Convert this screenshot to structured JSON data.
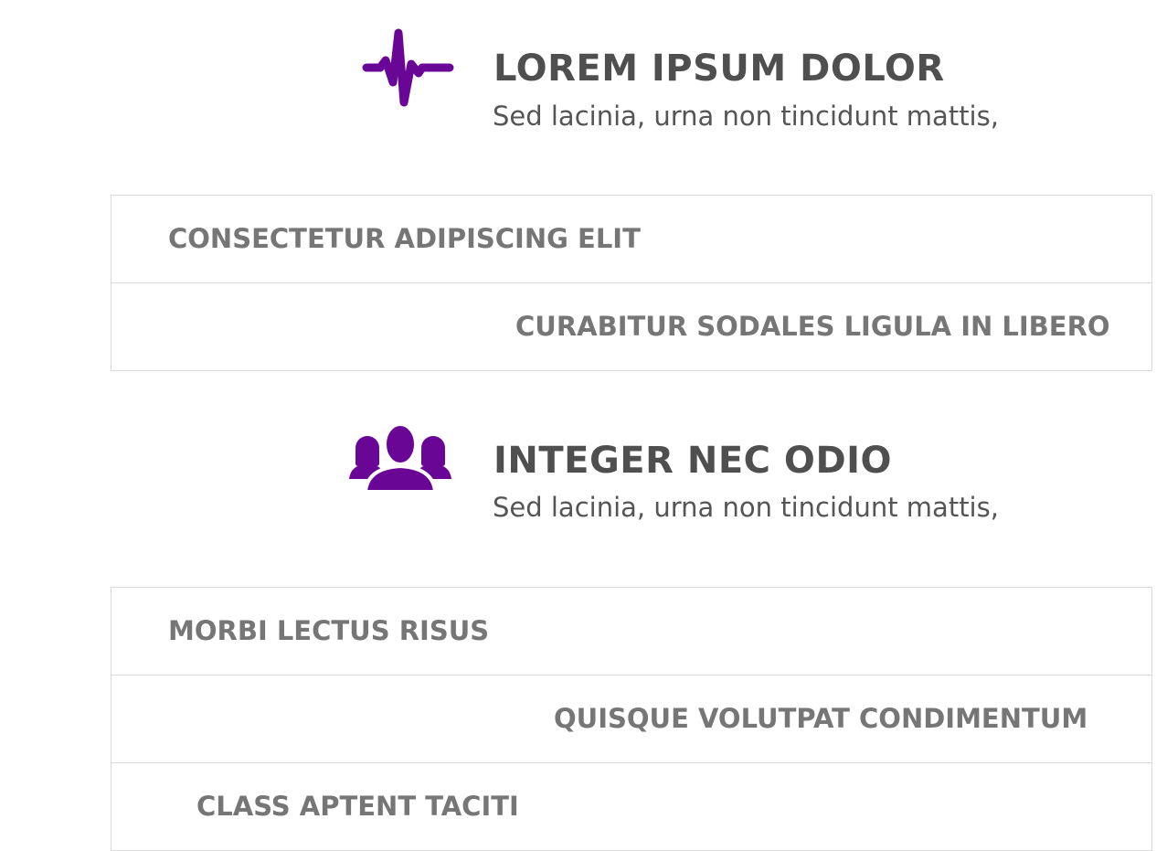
{
  "accent_color": "#6a0696",
  "sections": [
    {
      "icon": "heartbeat-icon",
      "title": "LOREM IPSUM DOLOR",
      "subtitle": "Sed lacinia, urna non tincidunt mattis,",
      "items": [
        "CONSECTETUR ADIPISCING ELIT",
        "CURABITUR SODALES LIGULA IN LIBERO"
      ]
    },
    {
      "icon": "users-group-icon",
      "title": "INTEGER NEC ODIO",
      "subtitle": "Sed lacinia, urna non tincidunt mattis,",
      "items": [
        "MORBI LECTUS RISUS",
        "QUISQUE VOLUTPAT CONDIMENTUM",
        "CLASS APTENT TACITI"
      ]
    }
  ]
}
